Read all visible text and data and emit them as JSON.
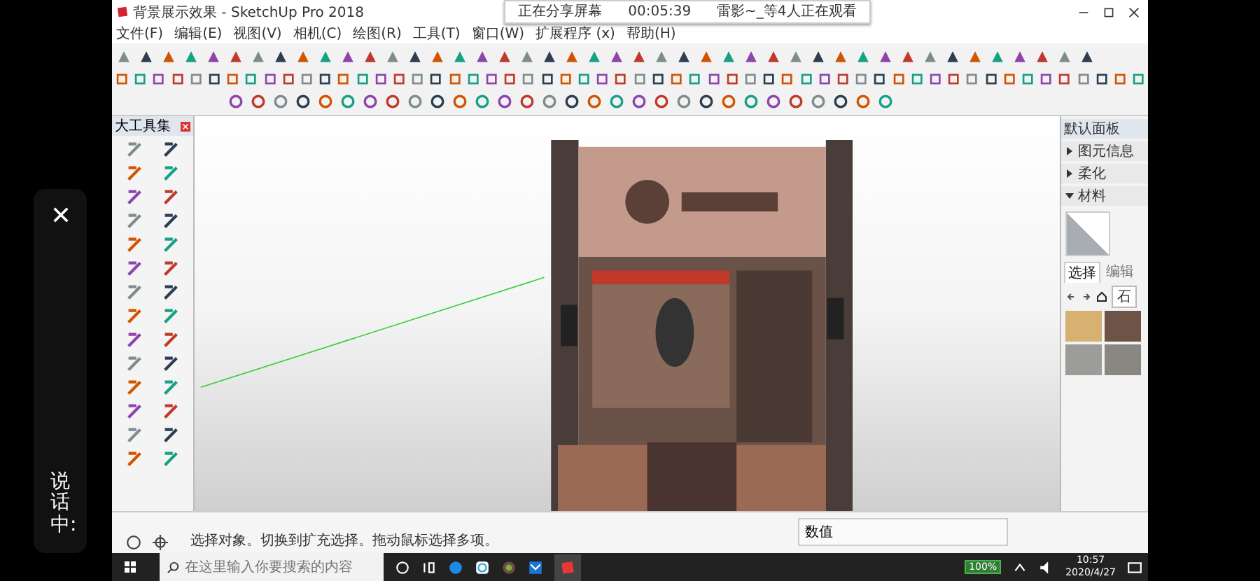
{
  "phone_overlay": {
    "status": "说话中:"
  },
  "window": {
    "title": "背景展示效果 - SketchUp Pro 2018"
  },
  "menu": [
    "文件(F)",
    "编辑(E)",
    "视图(V)",
    "相机(C)",
    "绘图(R)",
    "工具(T)",
    "窗口(W)",
    "扩展程序 (x)",
    "帮助(H)"
  ],
  "share_banner": {
    "status": "正在分享屏幕",
    "timer": "00:05:39",
    "viewers": "雷影~_等4人正在观看"
  },
  "tool_palette": {
    "title": "大工具集"
  },
  "tray": {
    "title": "默认面板",
    "sections": [
      {
        "label": "图元信息",
        "expanded": false
      },
      {
        "label": "柔化",
        "expanded": false
      },
      {
        "label": "材料",
        "expanded": true
      }
    ],
    "tabs": [
      {
        "label": "选择",
        "selected": true
      },
      {
        "label": "编辑",
        "selected": false
      }
    ],
    "library": "石"
  },
  "status_bar": {
    "hint": "选择对象。切换到扩充选择。拖动鼠标选择多项。",
    "measurements_label": "数值"
  },
  "taskbar": {
    "search_placeholder": "在这里输入你要搜索的内容",
    "battery": "100%",
    "time": "10:57",
    "date": "2020/4/27"
  }
}
